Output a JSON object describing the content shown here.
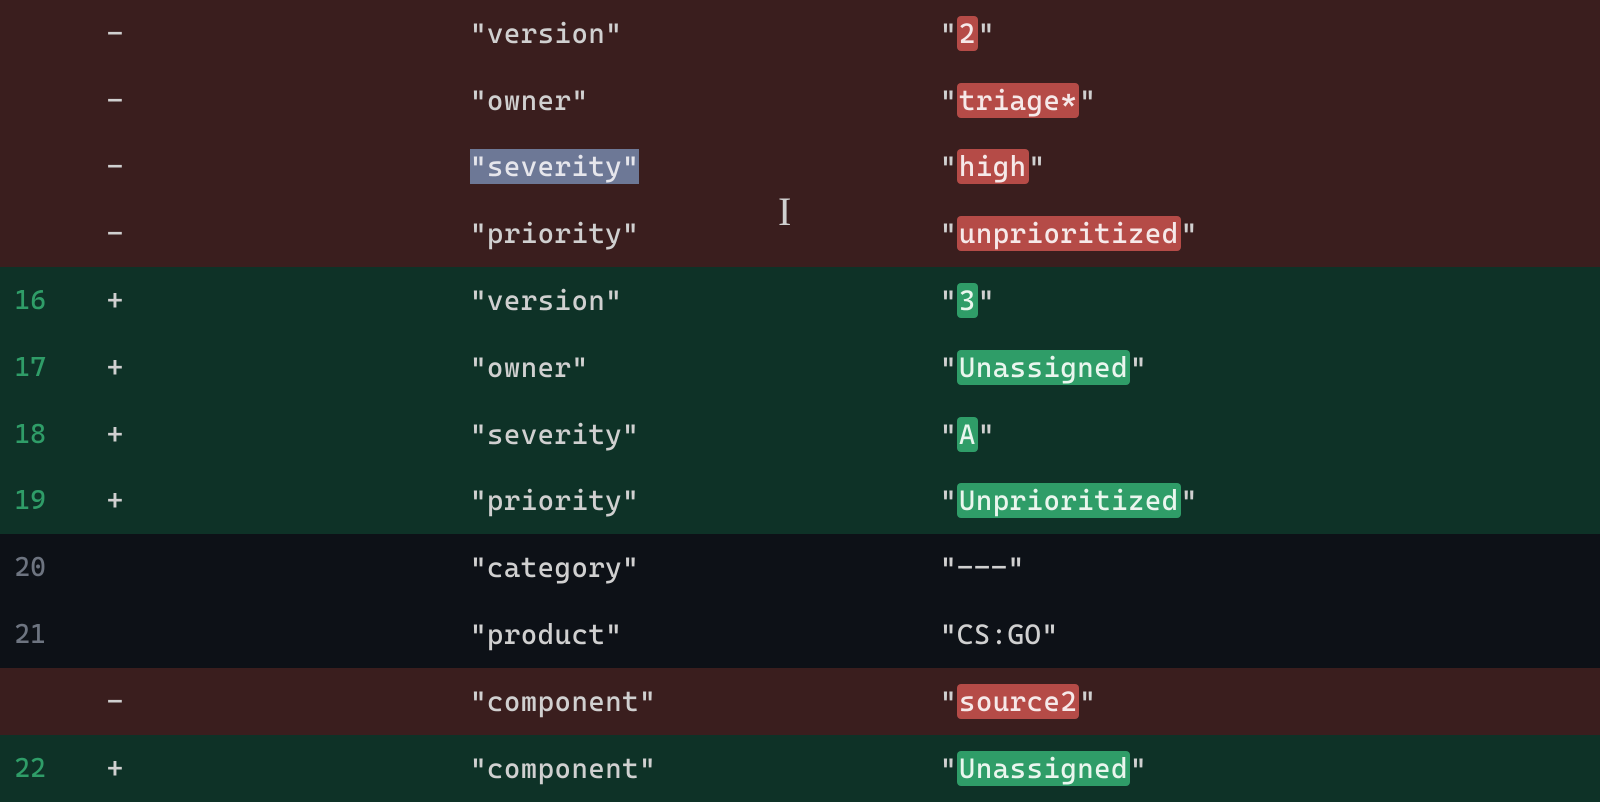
{
  "lines": [
    {
      "type": "removed",
      "lineNum": "",
      "marker": "-",
      "key": "\"version\"",
      "val_pre": "\"",
      "val_hl": "2",
      "val_post": "\"",
      "hlClass": "hl-red",
      "keyHl": ""
    },
    {
      "type": "removed",
      "lineNum": "",
      "marker": "-",
      "key": "\"owner\"",
      "val_pre": "\"",
      "val_hl": "triage*",
      "val_post": "\"",
      "hlClass": "hl-red",
      "keyHl": ""
    },
    {
      "type": "removed",
      "lineNum": "",
      "marker": "-",
      "key": "\"severity\"",
      "val_pre": "\"",
      "val_hl": "high",
      "val_post": "\"",
      "hlClass": "hl-red",
      "keyHl": "hl-selection"
    },
    {
      "type": "removed",
      "lineNum": "",
      "marker": "-",
      "key": "\"priority\"",
      "val_pre": "\"",
      "val_hl": "unprioritized",
      "val_post": "\"",
      "hlClass": "hl-red",
      "keyHl": ""
    },
    {
      "type": "added",
      "lineNum": "16",
      "marker": "+",
      "key": "\"version\"",
      "val_pre": "\"",
      "val_hl": "3",
      "val_post": "\"",
      "hlClass": "hl-green",
      "keyHl": ""
    },
    {
      "type": "added",
      "lineNum": "17",
      "marker": "+",
      "key": "\"owner\"",
      "val_pre": "\"",
      "val_hl": "Unassigned",
      "val_post": "\"",
      "hlClass": "hl-green",
      "keyHl": ""
    },
    {
      "type": "added",
      "lineNum": "18",
      "marker": "+",
      "key": "\"severity\"",
      "val_pre": "\"",
      "val_hl": "A",
      "val_post": "\"",
      "hlClass": "hl-green",
      "keyHl": ""
    },
    {
      "type": "added",
      "lineNum": "19",
      "marker": "+",
      "key": "\"priority\"",
      "val_pre": "\"",
      "val_hl": "Unprioritized",
      "val_post": "\"",
      "hlClass": "hl-green",
      "keyHl": ""
    },
    {
      "type": "context",
      "lineNum": "20",
      "marker": "",
      "key": "\"category\"",
      "val_pre": "\"---\"",
      "val_hl": "",
      "val_post": "",
      "hlClass": "",
      "keyHl": ""
    },
    {
      "type": "context",
      "lineNum": "21",
      "marker": "",
      "key": "\"product\"",
      "val_pre": "\"CS:GO\"",
      "val_hl": "",
      "val_post": "",
      "hlClass": "",
      "keyHl": ""
    },
    {
      "type": "removed",
      "lineNum": "",
      "marker": "-",
      "key": "\"component\"",
      "val_pre": "\"",
      "val_hl": "source2",
      "val_post": "\"",
      "hlClass": "hl-red",
      "keyHl": ""
    },
    {
      "type": "added",
      "lineNum": "22",
      "marker": "+",
      "key": "\"component\"",
      "val_pre": "\"",
      "val_hl": "Unassigned",
      "val_post": "\"",
      "hlClass": "hl-green",
      "keyHl": ""
    }
  ],
  "cursor_glyph": "I"
}
